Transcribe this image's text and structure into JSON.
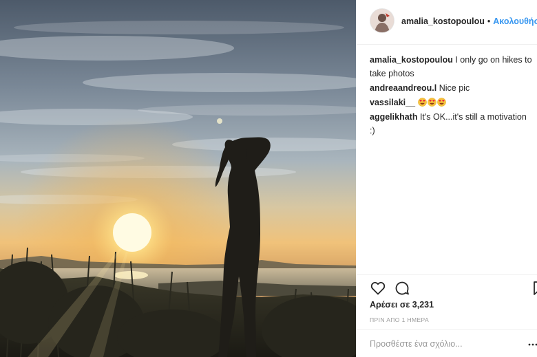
{
  "post": {
    "photo_alt": "",
    "author": {
      "username": "amalia_kostopoulou",
      "follow_label": "Ακολουθήστε",
      "separator": "•"
    },
    "comments": [
      {
        "user": "amalia_kostopoulou",
        "text": "I only go on hikes to take photos"
      },
      {
        "user": "andreaandreou.l",
        "text": "Nice pic"
      },
      {
        "user": "vassilaki__",
        "text": "",
        "emoji_count": 3,
        "emoji": "heart-eyes-emoji"
      },
      {
        "user": "aggelikhath",
        "text": "It's OK...it's still a motivation :)"
      }
    ],
    "likes_label": "Αρέσει σε 3,231",
    "timestamp": "ΠΡΙΝ ΑΠΟ 1 ΗΜΕΡΑ",
    "comment_placeholder": "Προσθέστε ένα σχόλιο...",
    "icons": {
      "like": "heart-icon",
      "comment": "comment-icon",
      "save": "bookmark-icon",
      "more": "more-options-icon"
    },
    "colors": {
      "link": "#3897f0",
      "text": "#262626",
      "muted": "#999999",
      "divider": "#efefef"
    }
  }
}
